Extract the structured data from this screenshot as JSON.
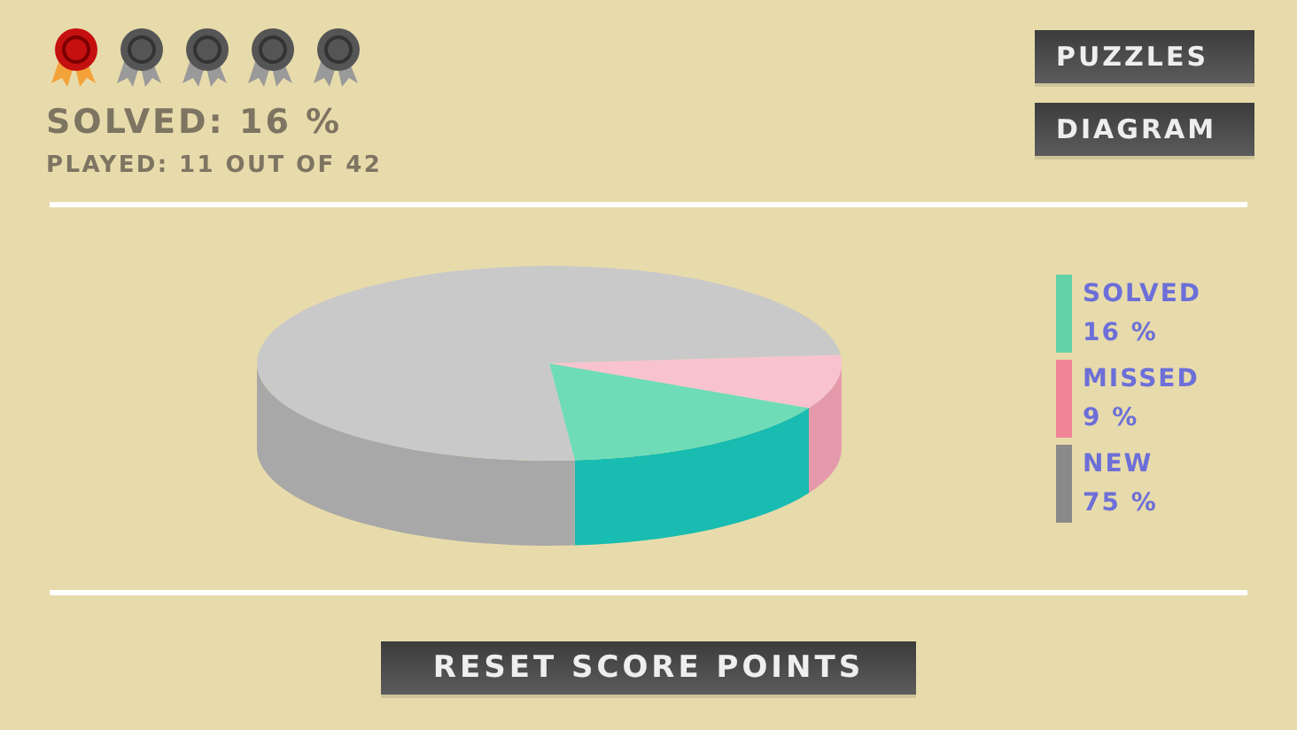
{
  "medals": [
    {
      "earned": true
    },
    {
      "earned": false
    },
    {
      "earned": false
    },
    {
      "earned": false
    },
    {
      "earned": false
    }
  ],
  "solved_text": "SOLVED: 16 %",
  "played_text": "PLAYED: 11 OUT OF 42",
  "nav_buttons": [
    "PUZZLES",
    "DIAGRAM"
  ],
  "legend": [
    {
      "label": "SOLVED",
      "value": "16 %",
      "color": "#62d2a8"
    },
    {
      "label": "MISSED",
      "value": "9 %",
      "color": "#f08598"
    },
    {
      "label": "NEW",
      "value": "75 %",
      "color": "#8a8a8a"
    }
  ],
  "reset_button": "RESET SCORE POINTS"
}
